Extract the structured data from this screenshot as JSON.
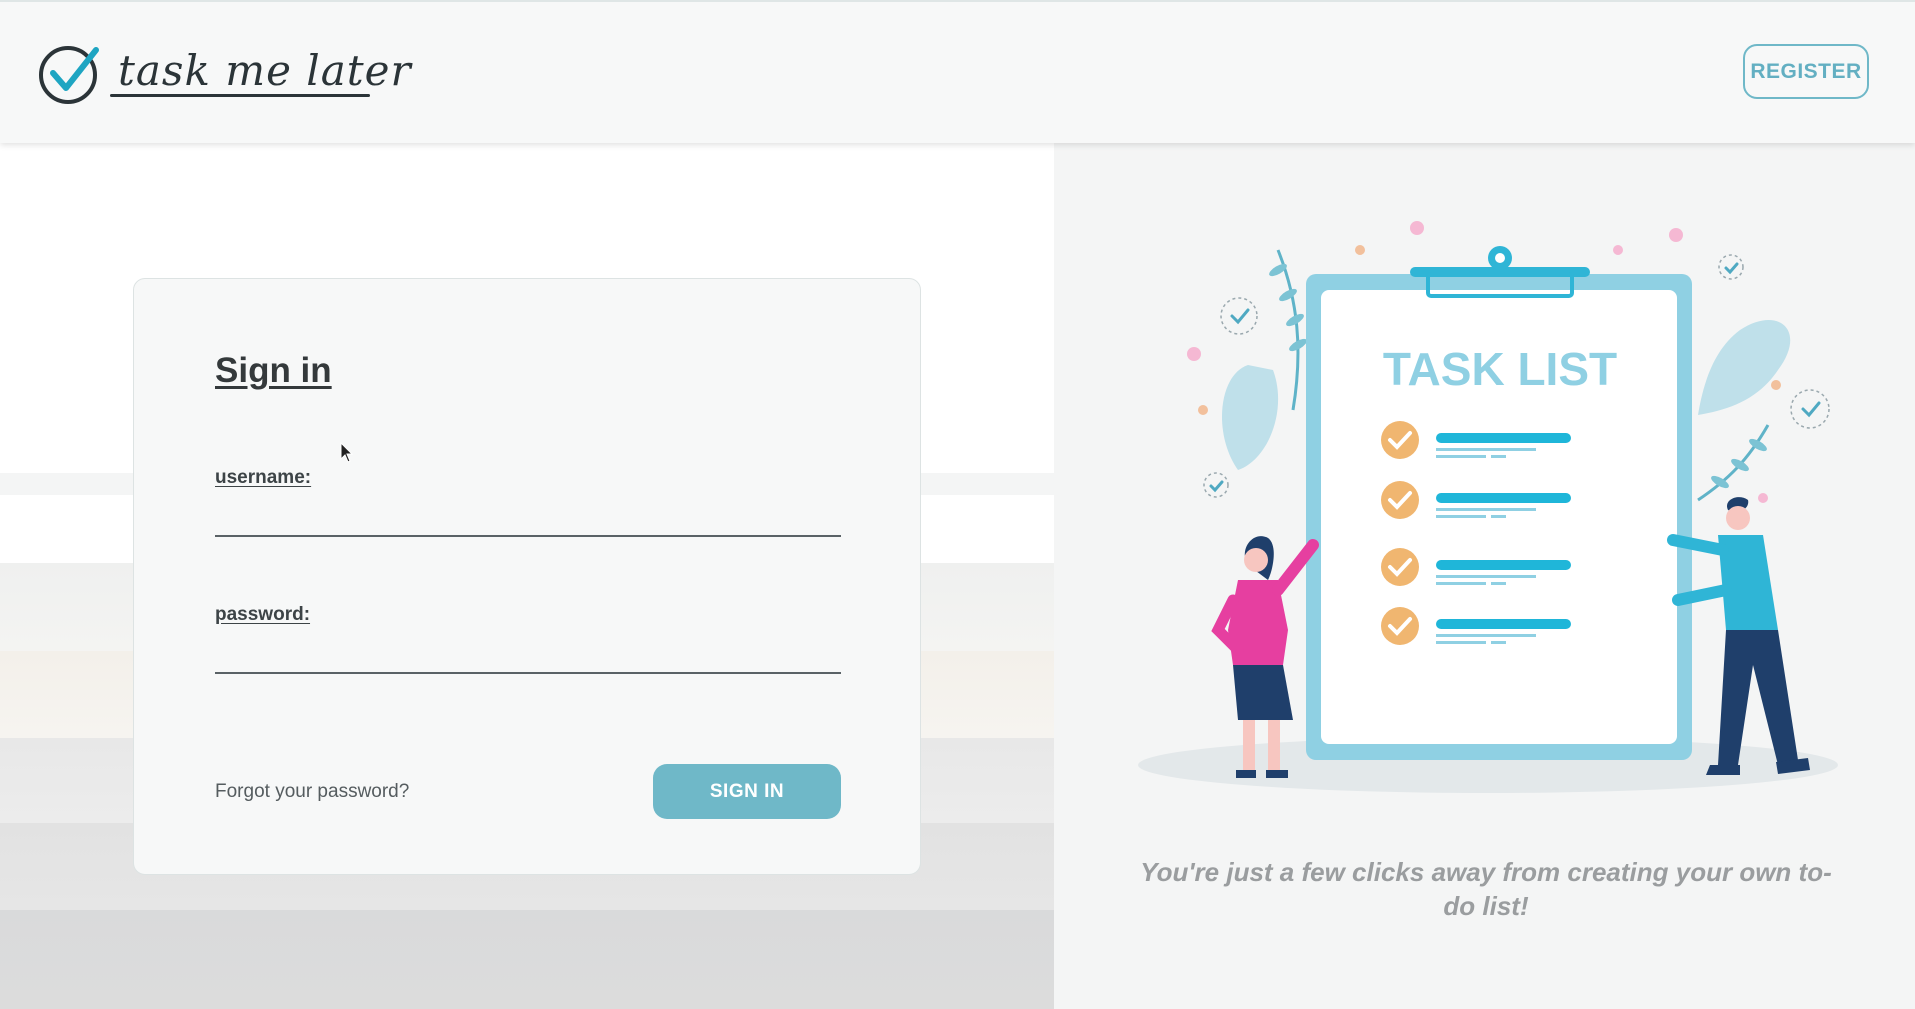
{
  "header": {
    "logo_text": "task me later",
    "register_label": "REGISTER"
  },
  "signin": {
    "title": "Sign in",
    "username_label": "username:",
    "username_value": "",
    "password_label": "password:",
    "password_value": "",
    "forgot_label": "Forgot your password?",
    "button_label": "SIGN IN"
  },
  "hero": {
    "illustration_title": "TASK LIST",
    "tagline": "You're just a few clicks away from creating your own to-do list!"
  },
  "colors": {
    "accent": "#6fb8c8",
    "dark": "#2b3438",
    "check_orange": "#f0b670",
    "line_blue": "#1fb6d9",
    "clipboard_blue": "#8fd0e3"
  },
  "icons": {
    "logo": "check-circle-icon",
    "cursor": "mouse-pointer-icon"
  }
}
